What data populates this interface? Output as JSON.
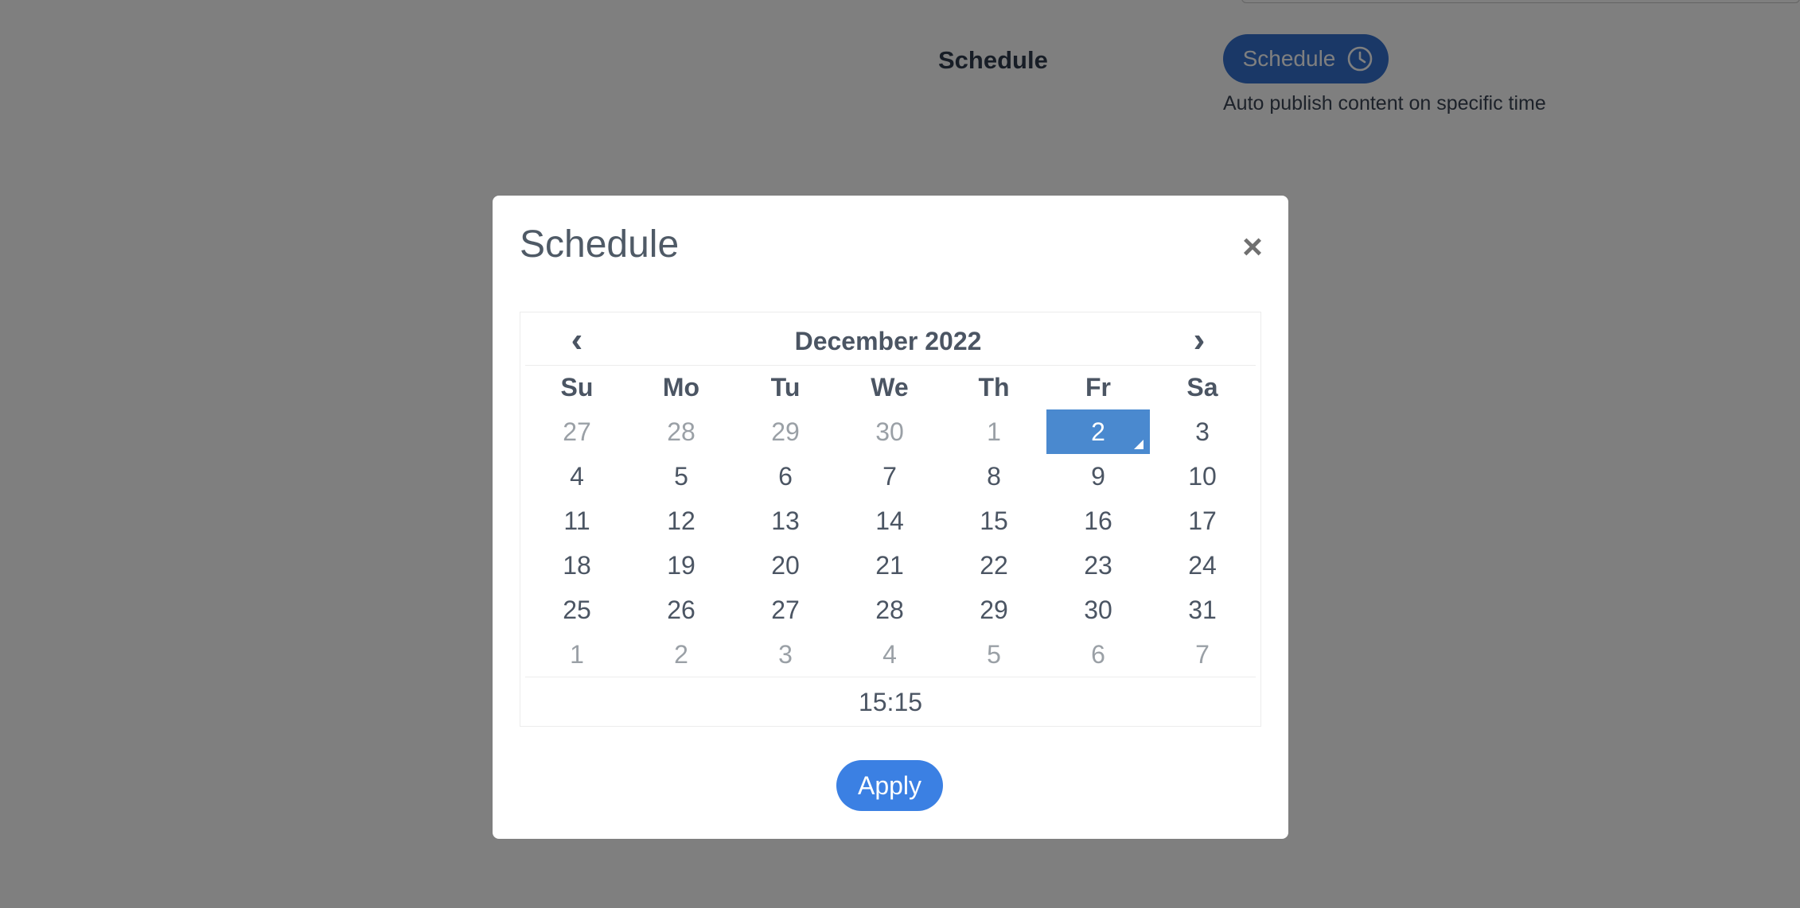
{
  "background": {
    "field_label": "Schedule",
    "schedule_button_label": "Schedule",
    "schedule_button_icon": "clock-icon",
    "help_text": "Auto publish content on specific time"
  },
  "modal": {
    "title": "Schedule",
    "close_symbol": "×",
    "apply_label": "Apply"
  },
  "calendar": {
    "month_label": "December 2022",
    "prev_symbol": "‹",
    "next_symbol": "›",
    "weekdays": [
      "Su",
      "Mo",
      "Tu",
      "We",
      "Th",
      "Fr",
      "Sa"
    ],
    "weeks": [
      [
        {
          "d": "27",
          "muted": true
        },
        {
          "d": "28",
          "muted": true
        },
        {
          "d": "29",
          "muted": true
        },
        {
          "d": "30",
          "muted": true
        },
        {
          "d": "1",
          "muted": true
        },
        {
          "d": "2",
          "selected": true
        },
        {
          "d": "3"
        }
      ],
      [
        {
          "d": "4"
        },
        {
          "d": "5"
        },
        {
          "d": "6"
        },
        {
          "d": "7"
        },
        {
          "d": "8"
        },
        {
          "d": "9"
        },
        {
          "d": "10"
        }
      ],
      [
        {
          "d": "11"
        },
        {
          "d": "12"
        },
        {
          "d": "13"
        },
        {
          "d": "14"
        },
        {
          "d": "15"
        },
        {
          "d": "16"
        },
        {
          "d": "17"
        }
      ],
      [
        {
          "d": "18"
        },
        {
          "d": "19"
        },
        {
          "d": "20"
        },
        {
          "d": "21"
        },
        {
          "d": "22"
        },
        {
          "d": "23"
        },
        {
          "d": "24"
        }
      ],
      [
        {
          "d": "25"
        },
        {
          "d": "26"
        },
        {
          "d": "27"
        },
        {
          "d": "28"
        },
        {
          "d": "29"
        },
        {
          "d": "30"
        },
        {
          "d": "31"
        }
      ],
      [
        {
          "d": "1",
          "muted": true
        },
        {
          "d": "2",
          "muted": true
        },
        {
          "d": "3",
          "muted": true
        },
        {
          "d": "4",
          "muted": true
        },
        {
          "d": "5",
          "muted": true
        },
        {
          "d": "6",
          "muted": true
        },
        {
          "d": "7",
          "muted": true
        }
      ]
    ],
    "time": "15:15"
  },
  "colors": {
    "primary": "#3b80e3",
    "selected_day": "#4a89cf",
    "overlay": "rgba(0,0,0,0.5)"
  }
}
